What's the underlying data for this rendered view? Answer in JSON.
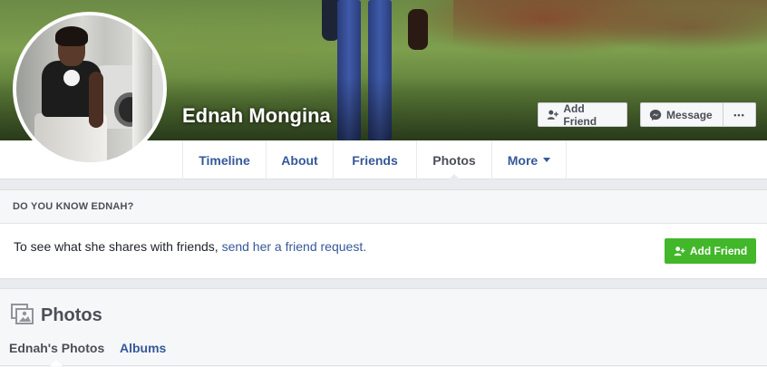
{
  "profile": {
    "name": "Ednah Mongina"
  },
  "cover_actions": {
    "add_friend_label": "Add Friend",
    "message_label": "Message",
    "more_label": "•••"
  },
  "nav": {
    "tabs": [
      {
        "label": "Timeline",
        "active": false
      },
      {
        "label": "About",
        "active": false
      },
      {
        "label": "Friends",
        "active": false
      },
      {
        "label": "Photos",
        "active": true
      },
      {
        "label": "More",
        "active": false
      }
    ]
  },
  "know_box": {
    "heading": "DO YOU KNOW EDNAH?",
    "text": "To see what she shares with friends, ",
    "link_text": "send her a friend request.",
    "button_label": "Add Friend"
  },
  "photos_section": {
    "title": "Photos",
    "subtabs": [
      {
        "label": "Ednah's Photos",
        "active": true
      },
      {
        "label": "Albums",
        "active": false
      }
    ]
  },
  "colors": {
    "link_blue": "#365899",
    "green_button": "#42b72a",
    "text_dark": "#4b4f56",
    "background": "#e9ebee"
  },
  "icons": [
    "add-friend-icon",
    "messenger-icon",
    "more-dots-icon",
    "caret-down-icon",
    "photos-icon"
  ]
}
